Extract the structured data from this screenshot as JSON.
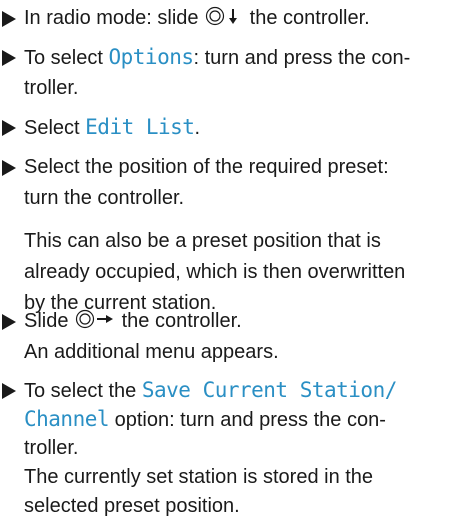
{
  "colors": {
    "text": "#1a1a1a",
    "menu_term": "#2a8fc4"
  },
  "icons": {
    "bullet": "triangle-right-icon",
    "controller": "controller-dial-icon",
    "slide_down": "arrow-down-icon",
    "slide_right": "arrow-right-icon"
  },
  "steps": [
    {
      "lines": [
        {
          "a": "In radio mode: slide",
          "b": "the controller."
        }
      ]
    },
    {
      "lines": [
        {
          "a": "To select",
          "term": "Options",
          "b": ": turn and press the con-"
        },
        {
          "a": "troller."
        }
      ]
    },
    {
      "lines": [
        {
          "a": "Select",
          "term": "Edit List",
          "b": "."
        }
      ]
    },
    {
      "lines": [
        {
          "a": "Select the position of the required preset:"
        },
        {
          "a": "turn the controller."
        }
      ],
      "note": [
        "This can also be a preset position that is",
        "already occupied, which is then overwritten",
        "by the current station."
      ]
    },
    {
      "lines": [
        {
          "a": "Slide",
          "b": "the controller."
        },
        {
          "a": "An additional menu appears."
        }
      ]
    },
    {
      "lines": [
        {
          "a": "To select the",
          "term": "Save Current Station/"
        },
        {
          "term": "Channel",
          "b": "option: turn and press the con-"
        },
        {
          "a": "troller."
        },
        {
          "a": "The currently set station is stored in the"
        },
        {
          "a": "selected preset position."
        }
      ]
    }
  ]
}
